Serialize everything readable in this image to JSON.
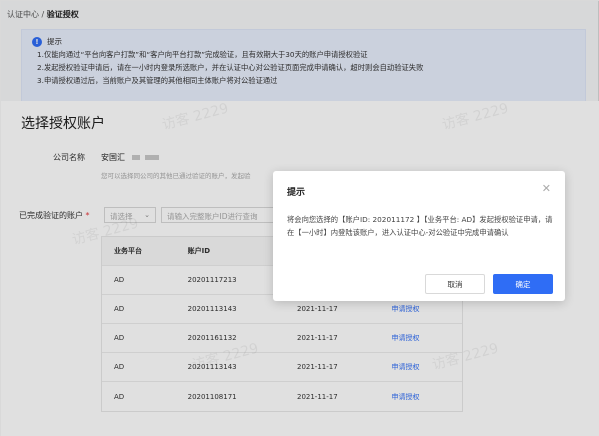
{
  "breadcrumb": {
    "parent": "认证中心",
    "separator": " / ",
    "current": "验证授权"
  },
  "notice": {
    "title": "提示",
    "lines": [
      "1.仅能向通过“平台向客户打款”和“客户向平台打款”完成验证，且有效期大于30天的账户申请授权验证",
      "2.发起授权验证申请后，请在一小时内登录所选账户，并在认证中心对公验证页面完成申请确认，超时则会自动验证失败",
      "3.申请授权通过后，当前账户及其管理的其他相同主体账户将对公验证通过"
    ]
  },
  "page": {
    "title": "选择授权账户"
  },
  "form": {
    "company_label": "公司名称",
    "company_value": "安国汇",
    "company_hint": "您可以选择同公司的其他已通过验证的账户，发起验",
    "verified_label": "已完成验证的账户",
    "required_mark": "*",
    "select_placeholder": "请选择",
    "search_placeholder": "请输入完整账户ID进行查询"
  },
  "table": {
    "headers": [
      "业务平台",
      "账户ID",
      "",
      ""
    ],
    "rows": [
      {
        "platform": "AD",
        "account_id": "20201117213",
        "date": "",
        "action": ""
      },
      {
        "platform": "AD",
        "account_id": "20201113143",
        "date": "2021-11-17",
        "action": "申请授权"
      },
      {
        "platform": "AD",
        "account_id": "20201161132",
        "date": "2021-11-17",
        "action": "申请授权"
      },
      {
        "platform": "AD",
        "account_id": "20201113143",
        "date": "2021-11-17",
        "action": "申请授权"
      },
      {
        "platform": "AD",
        "account_id": "20201108171",
        "date": "2021-11-17",
        "action": "申请授权"
      }
    ]
  },
  "watermark_text": "访客 2229",
  "dialog": {
    "title": "提示",
    "close_icon": "close-icon",
    "body": "将会向您选择的【账户ID: 202011172 】【业务平台: AD】发起授权验证申请，请在【一小时】内登陆该账户，进入认证中心-对公验证中完成申请确认",
    "cancel_label": "取消",
    "confirm_label": "确定"
  },
  "colors": {
    "primary": "#2f6df5",
    "notice_bg": "#e8eefc",
    "required": "#e6363a"
  }
}
